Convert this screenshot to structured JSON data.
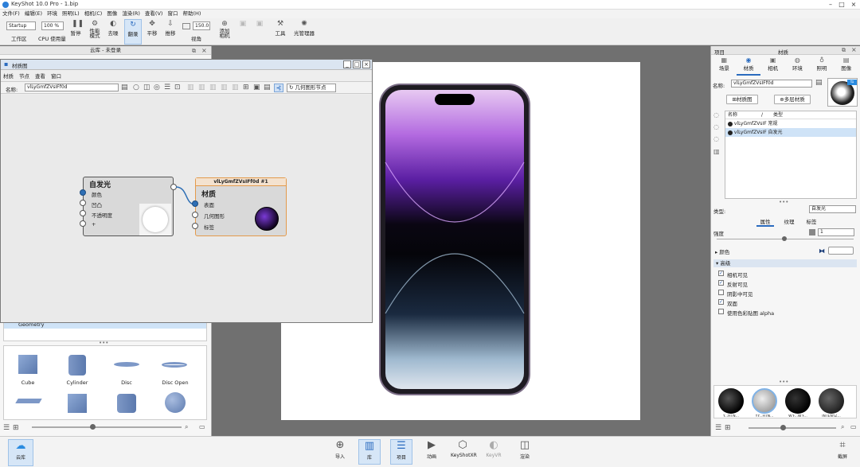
{
  "app": {
    "title": "KeyShot 10.0 Pro  - 1.bip"
  },
  "menu": [
    "文件(F)",
    "编辑(E)",
    "环境",
    "照明(L)",
    "相机(C)",
    "图像",
    "渲染(R)",
    "查看(V)",
    "窗口",
    "帮助(H)"
  ],
  "toolbar": {
    "workspace_select": "Startup",
    "zoom_select": "100 %",
    "fov_value": "150.0",
    "labels": [
      "工作区",
      "CPU 使用量",
      "暂停",
      "性能\n模式",
      "去噪",
      "翻录",
      "平移",
      "推移",
      "视角",
      "添加\n相机",
      "",
      "",
      "",
      "工具",
      "光管理器"
    ]
  },
  "library": {
    "title": "云库 - 未登录",
    "tree_item": "Geometry",
    "models": [
      "Cube",
      "Cylinder",
      "Disc",
      "Disc Open",
      "",
      "",
      "",
      ""
    ]
  },
  "material_graph": {
    "title": "材质图",
    "menu": [
      "材质",
      "节点",
      "查看",
      "窗口"
    ],
    "name_label": "名称:",
    "name_value": "vlLyGmfZVsIFf0d",
    "geo_node_button": "几何图形节点",
    "node_emissive": {
      "title": "自发光",
      "ports": [
        "颜色",
        "凹凸",
        "不透明度",
        "+"
      ]
    },
    "node_material": {
      "header": "vlLyGmfZVsIFf0d #1",
      "title": "材质",
      "ports": [
        "表面",
        "几何图形",
        "标签"
      ]
    }
  },
  "project": {
    "title": "项目",
    "material_title": "材质",
    "tabs": [
      "场景",
      "材质",
      "相机",
      "环境",
      "照明",
      "图像"
    ],
    "name_label": "名称:",
    "name_value": "vlLyGmfZVsIFf0d",
    "graph_button": "材质图",
    "multi_button": "多层材质",
    "list_headers": [
      "名称",
      "/",
      "类型"
    ],
    "list_rows": [
      {
        "name": "vlLyGmfZVsIF 常规",
        "sel": false
      },
      {
        "name": "vlLyGmfZVsIF 自发光",
        "sel": true
      }
    ],
    "type_label": "类型:",
    "type_value": "自发光",
    "subtabs": [
      "属性",
      "纹理",
      "标签"
    ],
    "intensity_label": "强度",
    "intensity_value": "1",
    "color_label": "颜色",
    "advanced_label": "高级",
    "checks": [
      {
        "label": "相机可见",
        "on": true
      },
      {
        "label": "反射可见",
        "on": true
      },
      {
        "label": "阴影中可见",
        "on": false
      },
      {
        "label": "双面",
        "on": true
      },
      {
        "label": "使用色彩贴图 alpha",
        "on": false
      }
    ],
    "swatch_labels": [
      "Y...HTN...",
      "YY...HTN...",
      "W'F...W'F...",
      "INTEN'IZ..."
    ]
  },
  "bottom": [
    "导入",
    "库",
    "项目",
    "动画",
    "KeyShotXR",
    "KeyVR",
    "渲染"
  ],
  "cloud_label": "云库",
  "screenshot_label": "截屏"
}
